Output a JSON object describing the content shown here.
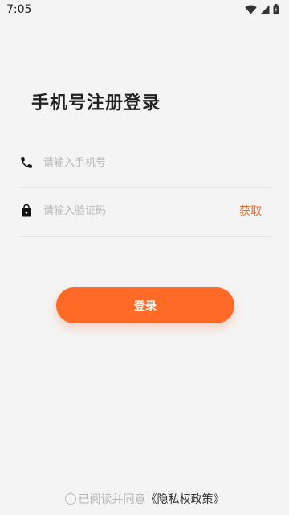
{
  "status_bar": {
    "time": "7:05",
    "icons": [
      "wifi-icon",
      "signal-icon",
      "battery-icon"
    ]
  },
  "title": "手机号注册登录",
  "form": {
    "phone": {
      "placeholder": "请输入手机号",
      "value": "",
      "icon": "phone-icon"
    },
    "code": {
      "placeholder": "请输入验证码",
      "value": "",
      "icon": "lock-icon",
      "action_label": "获取"
    }
  },
  "login_button": "登录",
  "agreement": {
    "text": "已阅读并同意",
    "policy_link": "《隐私权政策》",
    "checked": false
  },
  "colors": {
    "accent": "#ff6a26",
    "background": "#f4f4f4"
  }
}
